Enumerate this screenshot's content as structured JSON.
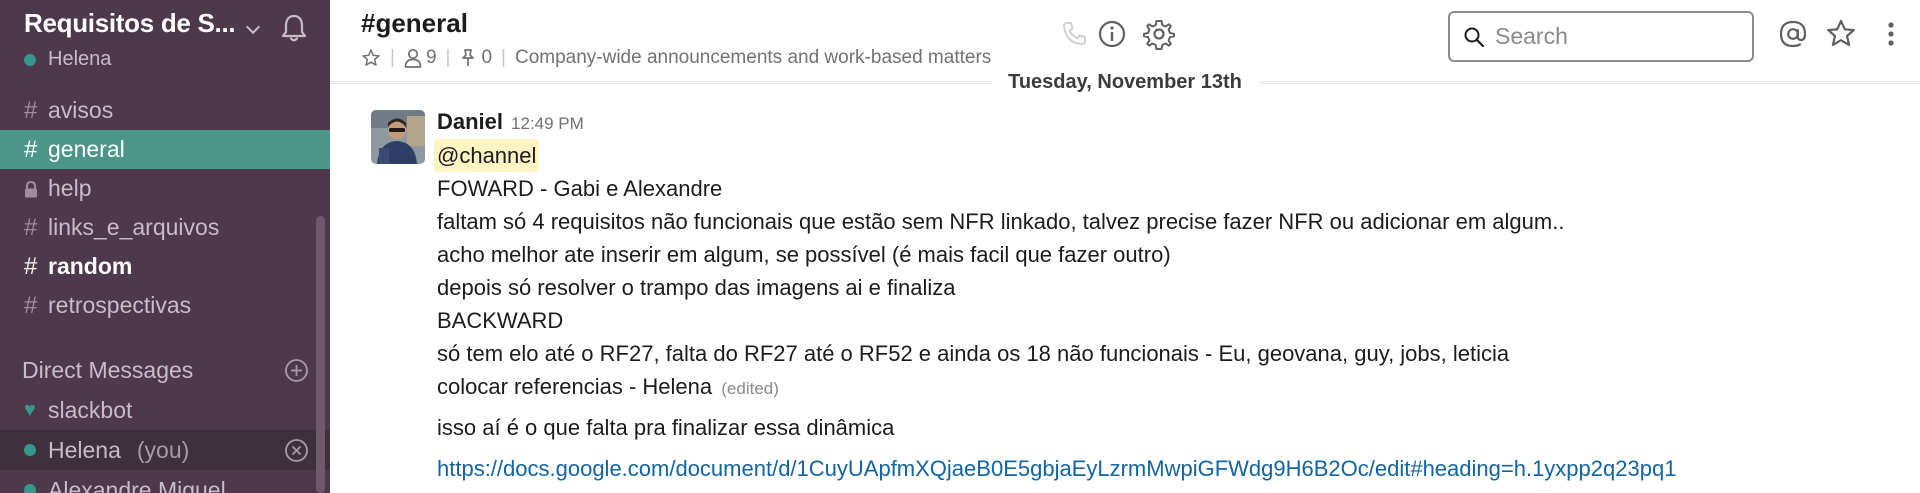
{
  "workspace": {
    "name": "Requisitos de S...",
    "user": "Helena"
  },
  "channels": [
    {
      "name": "avisos",
      "prefix": "#",
      "state": "normal"
    },
    {
      "name": "general",
      "prefix": "#",
      "state": "active"
    },
    {
      "name": "help",
      "prefix": "lock",
      "state": "normal"
    },
    {
      "name": "links_e_arquivos",
      "prefix": "#",
      "state": "normal"
    },
    {
      "name": "random",
      "prefix": "#",
      "state": "unread"
    },
    {
      "name": "retrospectivas",
      "prefix": "#",
      "state": "normal"
    }
  ],
  "direct_messages": {
    "header": "Direct Messages",
    "items": [
      {
        "name": "slackbot"
      },
      {
        "name": "Helena",
        "suffix": "(you)"
      },
      {
        "name": "Alexandre Miguel"
      }
    ]
  },
  "header": {
    "title": "#general",
    "members": "9",
    "pins": "0",
    "description": "Company-wide announcements and work-based matters",
    "search_placeholder": "Search"
  },
  "colors": {
    "sidebar_bg": "#4d394b",
    "active_channel": "#4c9689",
    "presence": "#38978d",
    "link": "#1264a3",
    "mention_bg": "#fff4c2"
  },
  "date_divider": "Tuesday, November 13th",
  "message": {
    "author": "Daniel",
    "time": "12:49 PM",
    "mention": "@channel",
    "lines": [
      "FOWARD - Gabi e Alexandre",
      "faltam só 4 requisitos não funcionais que estão sem NFR linkado, talvez precise fazer NFR ou adicionar em algum..",
      "acho melhor ate inserir em algum, se possível (é mais facil que fazer outro)",
      "depois só resolver o trampo das imagens ai e finaliza",
      "BACKWARD",
      "só tem elo até o RF27, falta do RF27 até o RF52 e ainda os 18 não funcionais - Eu, geovana, guy, jobs, leticia"
    ],
    "last_line": "colocar referencias - Helena",
    "edited": "(edited)",
    "followup": "isso aí é o que falta pra finalizar essa dinâmica",
    "link": "https://docs.google.com/document/d/1CuyUApfmXQjaeB0E5gbjaEyLzrmMwpiGFWdg9H6B2Oc/edit#heading=h.1yxpp2q23pq1"
  }
}
